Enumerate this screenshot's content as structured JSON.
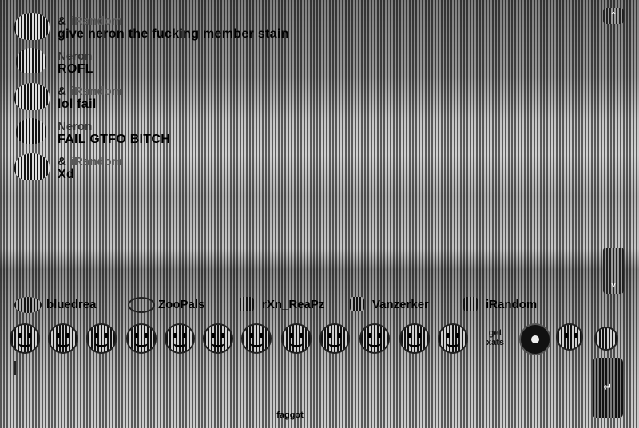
{
  "messages": [
    {
      "user": "iRandom",
      "prefix": "&",
      "text": "give neron the fucking member stain",
      "avatar": "pawn-avatar-icon"
    },
    {
      "user": "Neron",
      "prefix": "",
      "text": "ROFL",
      "avatar": "panda-avatar-icon"
    },
    {
      "user": "iRandom",
      "prefix": "&",
      "text": "lol fail",
      "avatar": "pawn-avatar-icon"
    },
    {
      "user": "Neron",
      "prefix": "",
      "text": "FAIL GTFO BITCH",
      "avatar": "panda-avatar-icon"
    },
    {
      "user": "iRandom",
      "prefix": "&",
      "text": "Xd",
      "avatar": "pawn-avatar-icon"
    }
  ],
  "scroll": {
    "up_glyph": "^",
    "down_glyph": "v"
  },
  "tabs": [
    {
      "label": "bluedrea",
      "icon": "chat-bubble-icon"
    },
    {
      "label": "ZooPals",
      "icon": "chat-bubble-outline-icon"
    },
    {
      "label": "rXn_ReaPz",
      "icon": "lock-icon"
    },
    {
      "label": "Vanzerker",
      "icon": "lock-icon"
    },
    {
      "label": "iRandom",
      "icon": "lock-icon"
    }
  ],
  "smileys": [
    "smile",
    "grin",
    "laugh",
    "surprised",
    "happy",
    "cool",
    "angry",
    "crying",
    "wink",
    "sad",
    "confused",
    "tongue"
  ],
  "get_xats_label": "get\nxats",
  "footer": {
    "text": "faggot"
  },
  "send": {
    "glyph": "↵"
  }
}
